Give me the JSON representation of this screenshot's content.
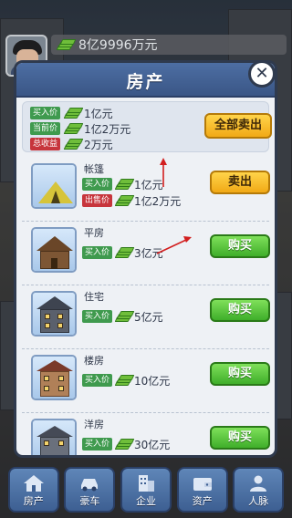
{
  "topbar": {
    "money": "8亿9996万元"
  },
  "modal": {
    "title": "房产",
    "summary": {
      "buy_label": "买入价",
      "buy_value": "1亿元",
      "current_label": "当前价",
      "current_value": "1亿2万元",
      "profit_label": "总收益",
      "profit_value": "2万元",
      "sell_all": "全部卖出"
    },
    "items": [
      {
        "name": "帐篷",
        "buy_label": "买入价",
        "buy_value": "1亿元",
        "sell_label": "出售价",
        "sell_value": "1亿2万元",
        "action": "卖出"
      },
      {
        "name": "平房",
        "buy_label": "买入价",
        "buy_value": "3亿元",
        "action": "购买"
      },
      {
        "name": "住宅",
        "buy_label": "买入价",
        "buy_value": "5亿元",
        "action": "购买"
      },
      {
        "name": "楼房",
        "buy_label": "买入价",
        "buy_value": "10亿元",
        "action": "购买"
      },
      {
        "name": "洋房",
        "buy_label": "买入价",
        "buy_value": "30亿元",
        "action": "购买"
      }
    ]
  },
  "nav": [
    {
      "label": "房产",
      "icon": "house-icon"
    },
    {
      "label": "豪车",
      "icon": "car-icon"
    },
    {
      "label": "企业",
      "icon": "building-icon"
    },
    {
      "label": "资产",
      "icon": "wallet-icon"
    },
    {
      "label": "人脉",
      "icon": "person-icon"
    }
  ],
  "colors": {
    "buy": "#3fae2a",
    "sell": "#f1a916",
    "tag_green": "#3f9a4e",
    "tag_red": "#c7353c",
    "header": "#4d6ea3"
  }
}
